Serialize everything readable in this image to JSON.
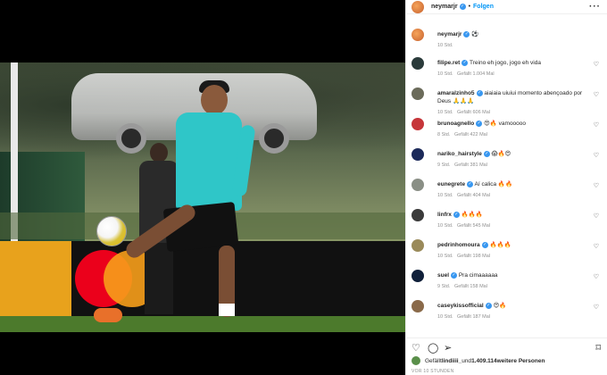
{
  "header": {
    "username": "neymarjr",
    "separator": "•",
    "follow_label": "Folgen",
    "more_icon": "more-horizontal-icon"
  },
  "caption": {
    "username": "neymarjr",
    "text": "⚽️",
    "time": "10 Std."
  },
  "comments": [
    {
      "username": "filipe.ret",
      "text": "Treino eh jogo, jogo eh vida",
      "time": "10 Std.",
      "likes": "Gefällt 1.004 Mal",
      "avatar_color": "#2b3b3b"
    },
    {
      "username": "amaralzinho5",
      "text": "aiaiaia uiuiui momento abençoado por Deus 🙏🙏🙏",
      "time": "10 Std.",
      "likes": "Gefällt 606 Mal",
      "avatar_color": "#6b6b5a"
    },
    {
      "username": "brunoagnello",
      "text": "😍🔥 vamooooo",
      "time": "8 Std.",
      "likes": "Gefällt 422 Mal",
      "avatar_color": "#c6363a"
    },
    {
      "username": "nariko_hairstyle",
      "text": "😱🔥😍",
      "time": "9 Std.",
      "likes": "Gefällt 381 Mal",
      "avatar_color": "#1c2a5a"
    },
    {
      "username": "eunegrete",
      "text": "Aí calica 🔥🔥",
      "time": "10 Std.",
      "likes": "Gefällt 404 Mal",
      "avatar_color": "#8a8f86"
    },
    {
      "username": "linfrx",
      "text": "🔥🔥🔥",
      "time": "10 Std.",
      "likes": "Gefällt 545 Mal",
      "avatar_color": "#3b3b3b"
    },
    {
      "username": "pedrinhomoura",
      "text": "🔥🔥🔥",
      "time": "10 Std.",
      "likes": "Gefällt 198 Mal",
      "avatar_color": "#9a8a5a"
    },
    {
      "username": "suel",
      "text": "Pra cimaaaaaa",
      "time": "9 Std.",
      "likes": "Gefällt 158 Mal",
      "avatar_color": "#10203a"
    },
    {
      "username": "caseykissofficial",
      "text": "😍🔥",
      "time": "10 Std.",
      "likes": "Gefällt 187 Mal",
      "avatar_color": "#8a6a4a"
    }
  ],
  "actions": {
    "like_icon": "heart-icon",
    "comment_icon": "comment-icon",
    "share_icon": "share-icon",
    "save_icon": "bookmark-icon"
  },
  "likes_summary": {
    "prefix": "Gefällt ",
    "user": "lindiiii_",
    "middle": " und ",
    "count": "1.409.114",
    "suffix": " weitere Personen"
  },
  "post_time": "VOR 10 STUNDEN",
  "colors": {
    "link_blue": "#0095f6",
    "verified_blue": "#3897f0",
    "muted": "#8e8e8e"
  }
}
